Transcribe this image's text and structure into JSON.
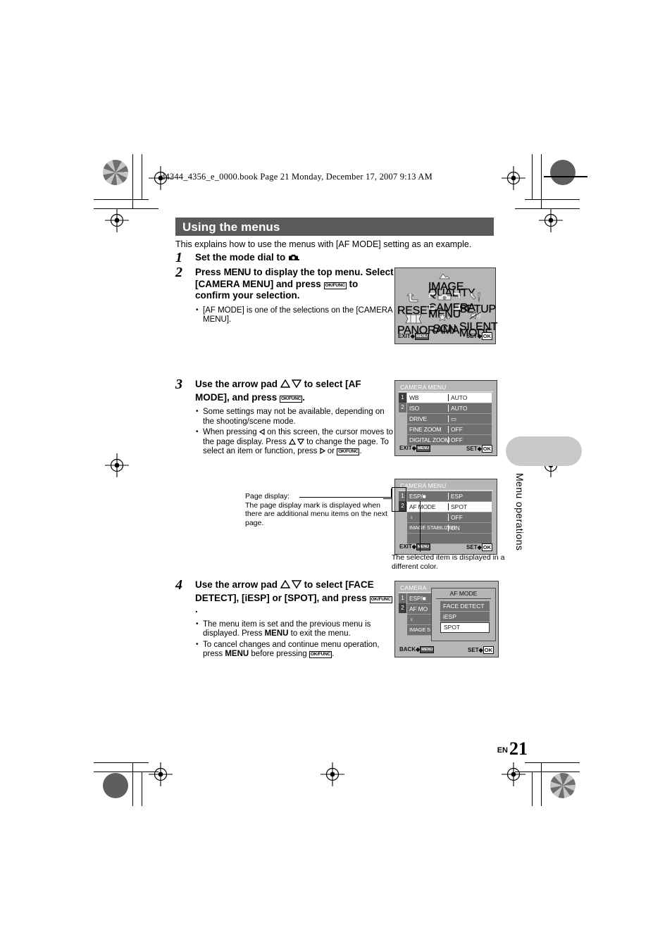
{
  "header": {
    "file_line": "d4344_4356_e_0000.book  Page 21  Monday, December 17, 2007  9:13 AM"
  },
  "section": {
    "title": "Using the menus",
    "intro": "This explains how to use the menus with [AF MODE] setting as an example."
  },
  "steps": [
    {
      "number": "1",
      "lead_a": "Set the mode dial to",
      "lead_b": ".",
      "bullets": []
    },
    {
      "number": "2",
      "lead_a": "Press",
      "lead_menu": "MENU",
      "lead_b": "to display the top menu. Select [CAMERA MENU] and press",
      "lead_key": "OK/FUNC",
      "lead_c": "to confirm your selection.",
      "bullets": [
        "[AF MODE] is one of the selections on the [CAMERA MENU]."
      ]
    },
    {
      "number": "3",
      "lead_a": "Use the arrow pad",
      "lead_b": "to select [AF MODE], and press",
      "lead_key": "OK/FUNC",
      "lead_c": ".",
      "bullets": [
        "Some settings may not be available, depending on the shooting/scene mode.",
        "When pressing ◁ on this screen, the cursor moves to the page display. Press △▽ to change the page. To select an item or function, press ▷ or OK/FUNC."
      ]
    },
    {
      "number": "4",
      "lead_a": "Use the arrow pad",
      "lead_b": "to select [FACE DETECT], [iESP] or [SPOT], and press",
      "lead_key": "OK/FUNC",
      "lead_c": ".",
      "bullets": [
        "The menu item is set and the previous menu is displayed. Press MENU to exit the menu.",
        "To cancel changes and continue menu operation, press MENU before pressing OK/FUNC."
      ]
    }
  ],
  "top_menu_screen": {
    "items": [
      {
        "label": "IMAGE QUALITY",
        "icon": "image-quality-icon"
      },
      {
        "label": "RESET",
        "icon": "reset-arrow-icon"
      },
      {
        "label": "CAMERA MENU",
        "icon": "camera-icon"
      },
      {
        "label": "SETUP",
        "icon": "wrench-screwdriver-icon"
      },
      {
        "label": "PANORAMA",
        "icon": "panorama-icon"
      },
      {
        "label": "SCN",
        "icon": "scene-star-icon"
      },
      {
        "label": "SILENT MODE",
        "icon": "silent-mode-icon"
      }
    ],
    "footer_left": "EXIT",
    "footer_left_key": "MENU",
    "footer_right": "SET",
    "footer_right_key": "OK"
  },
  "camera_menu_page1": {
    "title": "CAMERA MENU",
    "tabs": [
      "1",
      "2"
    ],
    "active_tab": "1",
    "rows": [
      {
        "label": "WB",
        "value": "AUTO",
        "selected": true
      },
      {
        "label": "ISO",
        "value": "AUTO",
        "selected": false
      },
      {
        "label": "DRIVE",
        "value": "▭",
        "selected": false
      },
      {
        "label": "FINE ZOOM",
        "value": "OFF",
        "selected": false
      },
      {
        "label": "DIGITAL ZOOM",
        "value": "OFF",
        "selected": false
      }
    ],
    "footer_left": "EXIT",
    "footer_left_key": "MENU",
    "footer_right": "SET",
    "footer_right_key": "OK"
  },
  "camera_menu_page2": {
    "title": "CAMERA MENU",
    "tabs": [
      "1",
      "2"
    ],
    "active_tab": "2",
    "rows": [
      {
        "label": "ESP/■",
        "value": "ESP",
        "selected": false
      },
      {
        "label": "AF MODE",
        "value": "SPOT",
        "selected": true
      },
      {
        "label": "♀",
        "value": "OFF",
        "selected": false
      },
      {
        "label": "IMAGE STABILIZER",
        "value": "ON",
        "selected": false
      },
      {
        "label": "",
        "value": "",
        "selected": false
      }
    ],
    "footer_left": "EXIT",
    "footer_left_key": "MENU",
    "footer_right": "SET",
    "footer_right_key": "OK"
  },
  "af_mode_screen": {
    "background_title": "CAMERA",
    "background_tabs": [
      "1",
      "2"
    ],
    "background_rows": [
      {
        "label": "ESP/■"
      },
      {
        "label": "AF MO"
      },
      {
        "label": "♀"
      },
      {
        "label": "IMAGE S"
      }
    ],
    "submenu_title": "AF MODE",
    "submenu_options": [
      {
        "label": "FACE DETECT",
        "selected": false
      },
      {
        "label": "iESP",
        "selected": false
      },
      {
        "label": "SPOT",
        "selected": true
      }
    ],
    "footer_left": "BACK",
    "footer_left_key": "MENU",
    "footer_right": "SET",
    "footer_right_key": "OK"
  },
  "callouts": {
    "page_display": "Page display:\nThe page display mark is displayed when there are additional menu items on the next page.",
    "selected_item": "The selected item is displayed in a different color."
  },
  "side_tab": {
    "label": "Menu operations"
  },
  "folio": {
    "lang": "EN",
    "page": "21"
  },
  "colors": {
    "banner": "#5a5a5a",
    "lcd_bg": "#b6b6b6",
    "row_bg": "#6f6f6f",
    "row_selected_bg": "#ffffff",
    "side_tab": "#c9c9c9"
  }
}
